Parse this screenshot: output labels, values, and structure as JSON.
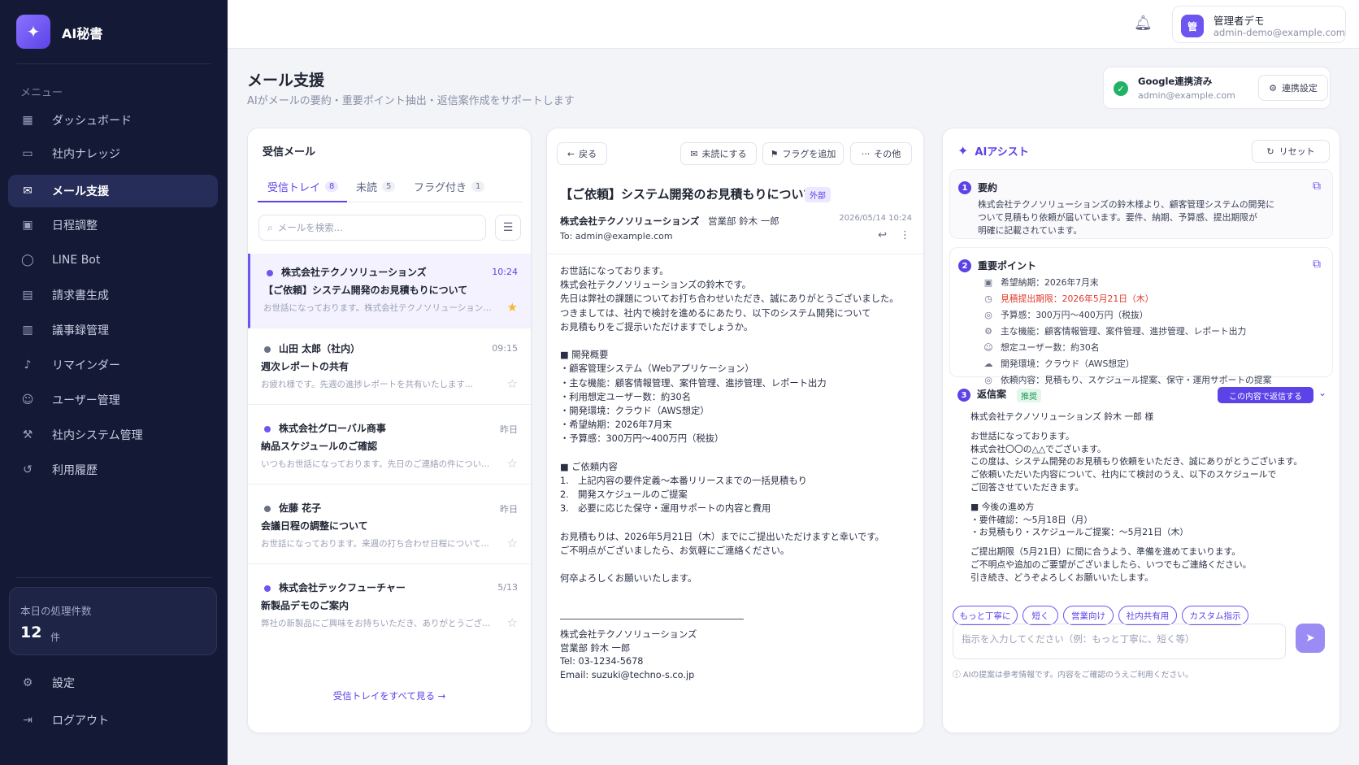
{
  "app": {
    "name": "AI秘書"
  },
  "sidebar": {
    "menu_heading": "メニュー",
    "items": [
      {
        "label": "ダッシュボード",
        "icon": "grid-icon"
      },
      {
        "label": "社内ナレッジ",
        "icon": "book-icon"
      },
      {
        "label": "メール支援",
        "icon": "mail-icon",
        "active": true
      },
      {
        "label": "日程調整",
        "icon": "calendar-icon"
      },
      {
        "label": "LINE Bot",
        "icon": "chat-icon"
      },
      {
        "label": "請求書生成",
        "icon": "invoice-icon"
      },
      {
        "label": "議事録管理",
        "icon": "document-icon"
      },
      {
        "label": "リマインダー",
        "icon": "bell-icon"
      },
      {
        "label": "ユーザー管理",
        "icon": "users-icon"
      },
      {
        "label": "社内システム管理",
        "icon": "wrench-icon"
      },
      {
        "label": "利用履歴",
        "icon": "history-icon"
      }
    ],
    "today_count": {
      "label": "本日の処理件数",
      "value": "12",
      "unit": "件"
    },
    "settings": "設定",
    "logout": "ログアウト"
  },
  "topbar": {
    "user_initial": "管",
    "user_name": "管理者デモ",
    "user_email": "admin-demo@example.com"
  },
  "page": {
    "title": "メール支援",
    "subtitle": "AIがメールの要約・重要ポイント抽出・返信案作成をサポートします",
    "google": {
      "status": "Google連携済み",
      "email": "admin@example.com",
      "settings_label": "連携設定"
    }
  },
  "inbox": {
    "title": "受信メール",
    "tabs": [
      {
        "label": "受信トレイ",
        "count": "8"
      },
      {
        "label": "未読",
        "count": "5"
      },
      {
        "label": "フラグ付き",
        "count": "1"
      }
    ],
    "search_placeholder": "メールを検索...",
    "mails": [
      {
        "sender": "株式会社テクノソリューションズ",
        "time": "10:24",
        "subject": "【ご依頼】システム開発のお見積もりについて",
        "preview": "お世話になっております。株式会社テクノソリューションズの鈴木です。",
        "starred": true
      },
      {
        "sender": "山田 太郎（社内）",
        "time": "09:15",
        "subject": "週次レポートの共有",
        "preview": "お疲れ様です。先週の進捗レポートを共有いたします...",
        "starred": false
      },
      {
        "sender": "株式会社グローバル商事",
        "time": "昨日",
        "subject": "納品スケジュールのご確認",
        "preview": "いつもお世話になっております。先日のご連絡の件について...",
        "starred": false
      },
      {
        "sender": "佐藤 花子",
        "time": "昨日",
        "subject": "会議日程の調整について",
        "preview": "お世話になっております。来週の打ち合わせ日程について...",
        "starred": false
      },
      {
        "sender": "株式会社テックフューチャー",
        "time": "5/13",
        "subject": "新製品デモのご案内",
        "preview": "弊社の新製品にご興味をお持ちいただき、ありがとうござ...",
        "starred": false
      }
    ],
    "see_all": "受信トレイをすべて見る →"
  },
  "detail": {
    "back": "戻る",
    "mark_unread": "未読にする",
    "add_flag": "フラグを追加",
    "more": "その他",
    "subject": "【ご依頼】システム開発のお見積もりについて",
    "external_badge": "外部",
    "sender": "株式会社テクノソリューションズ",
    "dept": "営業部 鈴木 一郎",
    "date": "2026/05/14 10:24",
    "to": "To: admin@example.com",
    "body": [
      "お世話になっております。",
      "株式会社テクノソリューションズの鈴木です。",
      "先日は弊社の課題についてお打ち合わせいただき、誠にありがとうございました。",
      "つきましては、社内で検討を進めるにあたり、以下のシステム開発について",
      "お見積もりをご提示いただけますでしょうか。",
      "",
      "■ 開発概要",
      "・顧客管理システム（Webアプリケーション）",
      "・主な機能：顧客情報管理、案件管理、進捗管理、レポート出力",
      "・利用想定ユーザー数：約30名",
      "・開発環境：クラウド（AWS想定）",
      "・希望納期：2026年7月末",
      "・予算感：300万円〜400万円（税抜）",
      "",
      "■ ご依頼内容",
      "1.　上記内容の要件定義〜本番リリースまでの一括見積もり",
      "2.　開発スケジュールのご提案",
      "3.　必要に応じた保守・運用サポートの内容と費用",
      "",
      "お見積もりは、2026年5月21日（木）までにご提出いただけますと幸いです。",
      "ご不明点がございましたら、お気軽にご連絡ください。",
      "",
      "何卒よろしくお願いいたします。",
      "",
      "",
      "――――――――――――――――――――",
      "株式会社テクノソリューションズ",
      "営業部 鈴木 一郎",
      "Tel: 03-1234-5678",
      "Email: suzuki@techno-s.co.jp"
    ]
  },
  "assist": {
    "title": "AIアシスト",
    "reset": "リセット",
    "summary": {
      "num": "1",
      "title": "要約",
      "lines": [
        "株式会社テクノソリューションズの鈴木様より、顧客管理システムの開発に",
        "ついて見積もり依頼が届いています。要件、納期、予算感、提出期限が",
        "明確に記載されています。"
      ]
    },
    "key_points": {
      "num": "2",
      "title": "重要ポイント",
      "items": [
        {
          "icon": "calendar-icon",
          "label": "希望納期：",
          "value": "2026年7月末",
          "highlight": false
        },
        {
          "icon": "clock-icon",
          "label": "見積提出期限：",
          "value": "2026年5月21日（木）",
          "highlight": true
        },
        {
          "icon": "money-icon",
          "label": "予算感：",
          "value": "300万円〜400万円（税抜）",
          "highlight": false
        },
        {
          "icon": "gear-icon",
          "label": "主な機能：",
          "value": "顧客情報管理、案件管理、進捗管理、レポート出力",
          "highlight": false
        },
        {
          "icon": "user-icon",
          "label": "想定ユーザー数：",
          "value": "約30名",
          "highlight": false
        },
        {
          "icon": "cloud-icon",
          "label": "開発環境：",
          "value": "クラウド（AWS想定）",
          "highlight": false
        },
        {
          "icon": "request-icon",
          "label": "依頼内容：",
          "value": "見積もり、スケジュール提案、保守・運用サポートの提案",
          "highlight": false
        }
      ]
    },
    "reply": {
      "num": "3",
      "title": "返信案",
      "badge": "推奨",
      "send_label": "この内容で返信する",
      "lines": [
        "株式会社テクノソリューションズ 鈴木 一郎 様",
        "",
        "お世話になっております。",
        "株式会社〇〇の△△でございます。",
        "この度は、システム開発のお見積もり依頼をいただき、誠にありがとうございます。",
        "ご依頼いただいた内容について、社内にて検討のうえ、以下のスケジュールで",
        "ご回答させていただきます。",
        "",
        "■ 今後の進め方",
        "・要件確認：〜5月18日（月）",
        "・お見積もり・スケジュールご提案：〜5月21日（木）",
        "",
        "ご提出期限（5月21日）に間に合うよう、準備を進めてまいります。",
        "ご不明点や追加のご要望がございましたら、いつでもご連絡ください。",
        "引き続き、どうぞよろしくお願いいたします。"
      ]
    },
    "chips": [
      "もっと丁寧に",
      "短く",
      "営業向け",
      "社内共有用",
      "カスタム指示"
    ],
    "prompt_placeholder": "指示を入力してください（例：もっと丁寧に、短く等）",
    "note": "ⓘ AIの提案は参考情報です。内容をご確認のうえご利用ください。"
  },
  "colors": {
    "accent": "#5b43e8",
    "sidebar": "#141a36",
    "deadline": "#e0392b",
    "success": "#22b266"
  }
}
